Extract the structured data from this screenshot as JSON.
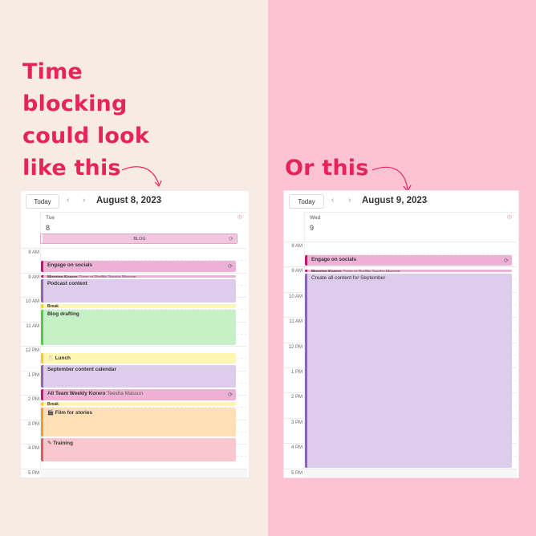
{
  "left": {
    "headline": [
      "Time",
      "blocking",
      "could look",
      "like this"
    ],
    "calendar": {
      "today_label": "Today",
      "prev_icon": "chevron-left-icon",
      "next_icon": "chevron-right-icon",
      "date_title": "August 8, 2023",
      "day_name": "Tue",
      "day_number": "8",
      "all_day_event": {
        "title": "BLOG",
        "recurring": true
      },
      "hours": [
        "8 AM",
        "9 AM",
        "10 AM",
        "11 AM",
        "12 PM",
        "1 PM",
        "2 PM",
        "3 PM",
        "4 PM",
        "5 PM"
      ],
      "events": [
        {
          "title": "Engage on socials",
          "subtitle": "",
          "start": 8.5,
          "end": 9.0,
          "bg": "#eeb1d6",
          "border": "#c3146f",
          "recurring": true,
          "icon": ""
        },
        {
          "title": "Morning Korero",
          "subtitle": "Zoom or Podlife Teesha Masson",
          "start": 9.08,
          "end": 9.25,
          "bg": "#eeb1d6",
          "border": "#c3146f",
          "recurring": false,
          "icon": "",
          "tiny": true
        },
        {
          "title": "Podcast content",
          "subtitle": "",
          "start": 9.25,
          "end": 10.25,
          "bg": "#ddcceb",
          "border": "#8a64c0",
          "recurring": false,
          "icon": ""
        },
        {
          "title": "Break",
          "subtitle": "",
          "start": 10.25,
          "end": 10.5,
          "bg": "#fff6b3",
          "border": "#f3d21f",
          "recurring": false,
          "icon": "",
          "tiny": true
        },
        {
          "title": "Blog drafting",
          "subtitle": "",
          "start": 10.5,
          "end": 12.0,
          "bg": "#c6f1c6",
          "border": "#4fcf3f",
          "recurring": false,
          "icon": ""
        },
        {
          "title": "Lunch",
          "subtitle": "",
          "start": 12.25,
          "end": 12.75,
          "bg": "#fff6b3",
          "border": "#f3d21f",
          "recurring": false,
          "icon": "fork-knife-icon"
        },
        {
          "title": "September content calendar",
          "subtitle": "",
          "start": 12.75,
          "end": 13.75,
          "bg": "#ddcceb",
          "border": "#8a64c0",
          "recurring": false,
          "icon": ""
        },
        {
          "title": "All Team Weekly Korero",
          "subtitle": "Teesha Masson",
          "start": 13.75,
          "end": 14.25,
          "bg": "#eeb1d6",
          "border": "#c3146f",
          "recurring": true,
          "icon": ""
        },
        {
          "title": "Break",
          "subtitle": "",
          "start": 14.25,
          "end": 14.5,
          "bg": "#fff6b3",
          "border": "#f3d21f",
          "recurring": false,
          "icon": "",
          "tiny": true
        },
        {
          "title": "Film for stories",
          "subtitle": "",
          "start": 14.5,
          "end": 15.75,
          "bg": "#ffdfb6",
          "border": "#f39a2a",
          "recurring": false,
          "icon": "clapperboard-icon"
        },
        {
          "title": "Training",
          "subtitle": "",
          "start": 15.75,
          "end": 16.75,
          "bg": "#f9c8cf",
          "border": "#e5556d",
          "recurring": false,
          "icon": "pencil-ruler-icon"
        }
      ]
    }
  },
  "right": {
    "headline": [
      "Or this"
    ],
    "calendar": {
      "today_label": "Today",
      "prev_icon": "chevron-left-icon",
      "next_icon": "chevron-right-icon",
      "date_title": "August 9, 2023",
      "day_name": "Wed",
      "day_number": "9",
      "hours": [
        "8 AM",
        "9 AM",
        "10 AM",
        "11 AM",
        "12 PM",
        "1 PM",
        "2 PM",
        "3 PM",
        "4 PM",
        "5 PM"
      ],
      "events": [
        {
          "title": "Engage on socials",
          "subtitle": "",
          "start": 8.5,
          "end": 9.0,
          "bg": "#eeb1d6",
          "border": "#c3146f",
          "recurring": true,
          "icon": ""
        },
        {
          "title": "Morning Korero",
          "subtitle": "Zoom or Podlife Teesha Masson",
          "start": 9.08,
          "end": 9.25,
          "bg": "#eeb1d6",
          "border": "#c3146f",
          "recurring": false,
          "icon": "",
          "tiny": true
        },
        {
          "title": "Create all content for September",
          "subtitle": "",
          "start": 9.25,
          "end": 17.0,
          "bg": "#ddcceb",
          "border": "#8a64c0",
          "recurring": false,
          "icon": "",
          "plain": true
        }
      ]
    }
  },
  "colors": {
    "headline": "#e6245a",
    "left_bg": "#f8ebe4",
    "right_bg": "#fdc3d4"
  }
}
